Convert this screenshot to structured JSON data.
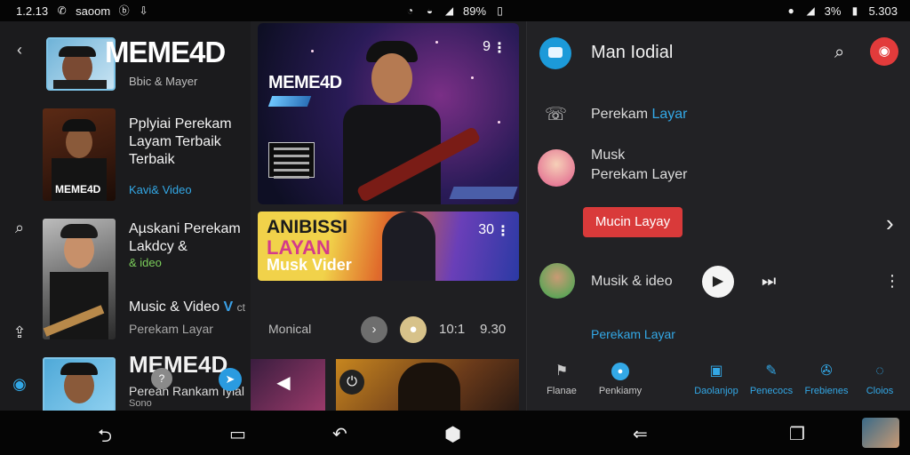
{
  "status_bar": {
    "time": "1.2.13",
    "carrier": "saoom",
    "battery_mid": "89%",
    "battery_right": "3%",
    "clock_right": "5.303",
    "icons": [
      "whatsapp-icon",
      "facebook-icon",
      "download-icon",
      "wifi-icon",
      "signal-icon",
      "battery-icon"
    ]
  },
  "left_pane": {
    "header": {
      "title": "MEME4D",
      "subtitle": "Bbic & Mayer"
    },
    "items": [
      {
        "title": "Pplyiai Perekam Layam Terbaik Terbaik",
        "thumb_caption": "MEME4D",
        "accent": "Kavi& Video"
      },
      {
        "title": "Aµskani Perekam Lakdcy &",
        "accent": "& ideo",
        "title2": "Music & Video",
        "badge": "V",
        "badge_suffix": "ct",
        "sub": "Perekam Layar"
      },
      {
        "title": "MEME4D",
        "sub": "Perean Rankam Iyial",
        "sub2": "Sono"
      }
    ]
  },
  "middle_pane": {
    "hero": {
      "logo": "MEME4D",
      "count": "9"
    },
    "banner": {
      "line1": "ANIBISSI",
      "line2": "LAYAN",
      "line3": "Musk Vider",
      "count": "30"
    },
    "controls": {
      "label": "Monical",
      "time1": "10:1",
      "time2": "9.30"
    }
  },
  "right_pane": {
    "header": {
      "title": "Man Iodial"
    },
    "items": [
      {
        "label": "Perekam",
        "accent": "Layar"
      },
      {
        "line1": "Musk",
        "line2": "Perekam Layer"
      },
      {
        "button": "Mucin Layay"
      },
      {
        "label": "Musik & ideo"
      },
      {
        "accent": "Perekam Layar"
      }
    ],
    "nav": [
      {
        "label": "Flanae",
        "icon": "flag-icon"
      },
      {
        "label": "Penkiamy",
        "icon": "globe-icon"
      },
      {
        "label": "Daolanjop",
        "icon": "home-icon"
      },
      {
        "label": "Penecocs",
        "icon": "edit-icon"
      },
      {
        "label": "Frebienes",
        "icon": "film-icon"
      },
      {
        "label": "Cloios",
        "icon": "chat-icon"
      }
    ]
  },
  "colors": {
    "accent": "#33a8e6",
    "red": "#d93a3a",
    "bg": "#1b1b1d"
  }
}
